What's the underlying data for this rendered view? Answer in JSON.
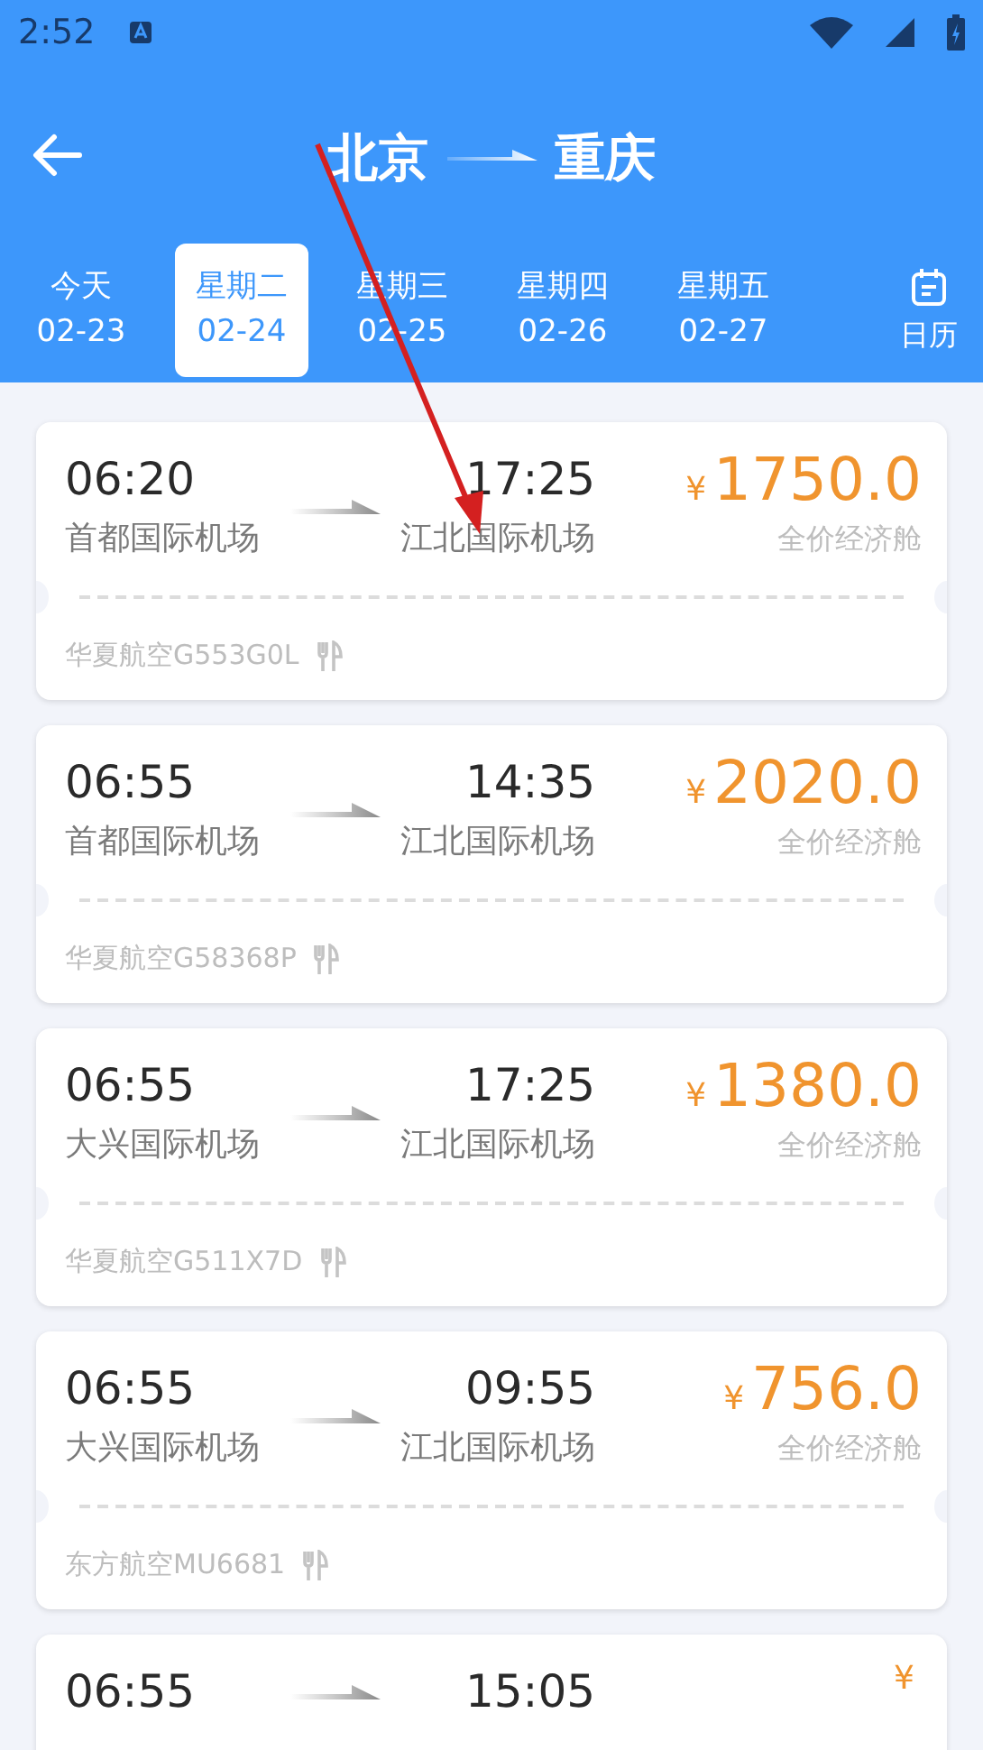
{
  "status_bar": {
    "time": "2:52"
  },
  "header": {
    "from": "北京",
    "to": "重庆"
  },
  "dates": [
    {
      "day": "今天",
      "date": "02-23",
      "selected": false
    },
    {
      "day": "星期二",
      "date": "02-24",
      "selected": true
    },
    {
      "day": "星期三",
      "date": "02-25",
      "selected": false
    },
    {
      "day": "星期四",
      "date": "02-26",
      "selected": false
    },
    {
      "day": "星期五",
      "date": "02-27",
      "selected": false
    }
  ],
  "calendar_button": {
    "label": "日历"
  },
  "flights": [
    {
      "depart_time": "06:20",
      "arrive_time": "17:25",
      "depart_airport": "首都国际机场",
      "arrive_airport": "江北国际机场",
      "currency": "¥",
      "price": "1750.0",
      "cabin": "全价经济舱",
      "flight": "华夏航空G553G0L"
    },
    {
      "depart_time": "06:55",
      "arrive_time": "14:35",
      "depart_airport": "首都国际机场",
      "arrive_airport": "江北国际机场",
      "currency": "¥",
      "price": "2020.0",
      "cabin": "全价经济舱",
      "flight": "华夏航空G58368P"
    },
    {
      "depart_time": "06:55",
      "arrive_time": "17:25",
      "depart_airport": "大兴国际机场",
      "arrive_airport": "江北国际机场",
      "currency": "¥",
      "price": "1380.0",
      "cabin": "全价经济舱",
      "flight": "华夏航空G511X7D"
    },
    {
      "depart_time": "06:55",
      "arrive_time": "09:55",
      "depart_airport": "大兴国际机场",
      "arrive_airport": "江北国际机场",
      "currency": "¥",
      "price": "756.0",
      "cabin": "全价经济舱",
      "flight": "东方航空MU6681"
    },
    {
      "depart_time": "06:55",
      "arrive_time": "15:05",
      "currency": "¥"
    }
  ]
}
